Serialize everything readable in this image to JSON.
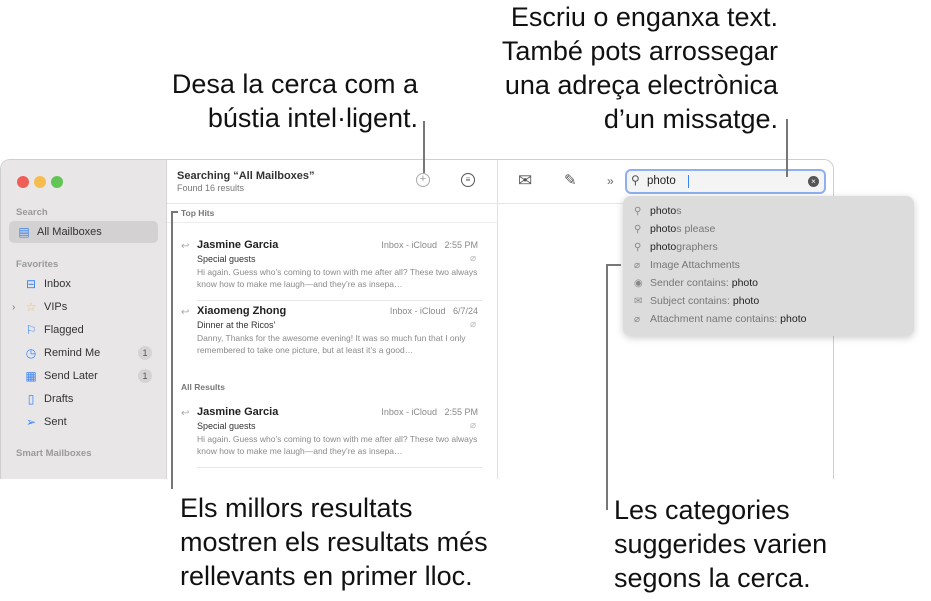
{
  "callouts": {
    "save_search": [
      "Desa la cerca com a",
      "bústia intel·ligent."
    ],
    "type_text": [
      "Escriu o enganxa text.",
      "També pots arrossegar",
      "una adreça electrònica",
      "d’un missatge."
    ],
    "top_hits": [
      "Els millors resultats",
      "mostren els resultats més",
      "rellevants en primer lloc."
    ],
    "categories": [
      "Les categories",
      "suggerides varien",
      "segons la cerca."
    ]
  },
  "sidebar": {
    "search_section": "Search",
    "all_mailboxes": "All Mailboxes",
    "favorites_section": "Favorites",
    "items": [
      {
        "label": "Inbox",
        "icon": "tray-icon"
      },
      {
        "label": "VIPs",
        "icon": "star-icon"
      },
      {
        "label": "Flagged",
        "icon": "flag-icon"
      },
      {
        "label": "Remind Me",
        "icon": "clock-icon",
        "badge": "1"
      },
      {
        "label": "Send Later",
        "icon": "calendar-icon",
        "badge": "1"
      },
      {
        "label": "Drafts",
        "icon": "document-icon"
      },
      {
        "label": "Sent",
        "icon": "paperplane-icon"
      }
    ],
    "smart_section": "Smart Mailboxes"
  },
  "list": {
    "title": "Searching “All Mailboxes”",
    "subtitle": "Found 16 results",
    "top_hits_label": "Top Hits",
    "all_results_label": "All Results",
    "top_hits": [
      {
        "from": "Jasmine Garcia",
        "mailbox": "Inbox - iCloud",
        "time": "2:55 PM",
        "subject": "Special guests",
        "preview": "Hi again. Guess who’s coming to town with me after all? These two always know how to make me laugh—and they’re as insepa…"
      },
      {
        "from": "Xiaomeng Zhong",
        "mailbox": "Inbox - iCloud",
        "time": "6/7/24",
        "subject": "Dinner at the Ricos'",
        "preview": "Danny, Thanks for the awesome evening! It was so much fun that I only remembered to take one picture, but at least it’s a good…"
      }
    ],
    "all_results": [
      {
        "from": "Jasmine Garcia",
        "mailbox": "Inbox - iCloud",
        "time": "2:55 PM",
        "subject": "Special guests",
        "preview": "Hi again. Guess who’s coming to town with me after all? These two always know how to make me laugh—and they’re as insepa…"
      }
    ]
  },
  "search": {
    "value": "photo"
  },
  "suggestions": [
    {
      "icon": "search-icon",
      "bold": "photo",
      "rest": "s",
      "suffix": ""
    },
    {
      "icon": "search-icon",
      "bold": "photo",
      "rest": "s please",
      "suffix": ""
    },
    {
      "icon": "search-icon",
      "bold": "photo",
      "rest": "graphers",
      "suffix": ""
    },
    {
      "icon": "paperclip-icon",
      "bold": "",
      "rest": "Image Attachments",
      "suffix": ""
    },
    {
      "icon": "person-icon",
      "bold": "",
      "rest": "Sender contains: ",
      "suffix": "photo"
    },
    {
      "icon": "envelope-icon",
      "bold": "",
      "rest": "Subject contains: ",
      "suffix": "photo"
    },
    {
      "icon": "paperclip-icon",
      "bold": "",
      "rest": "Attachment name contains: ",
      "suffix": "photo"
    }
  ],
  "colors": {
    "accent": "#3b82f6",
    "close": "#ee5f57",
    "minimize": "#f5bd4f",
    "zoom": "#61c454"
  }
}
